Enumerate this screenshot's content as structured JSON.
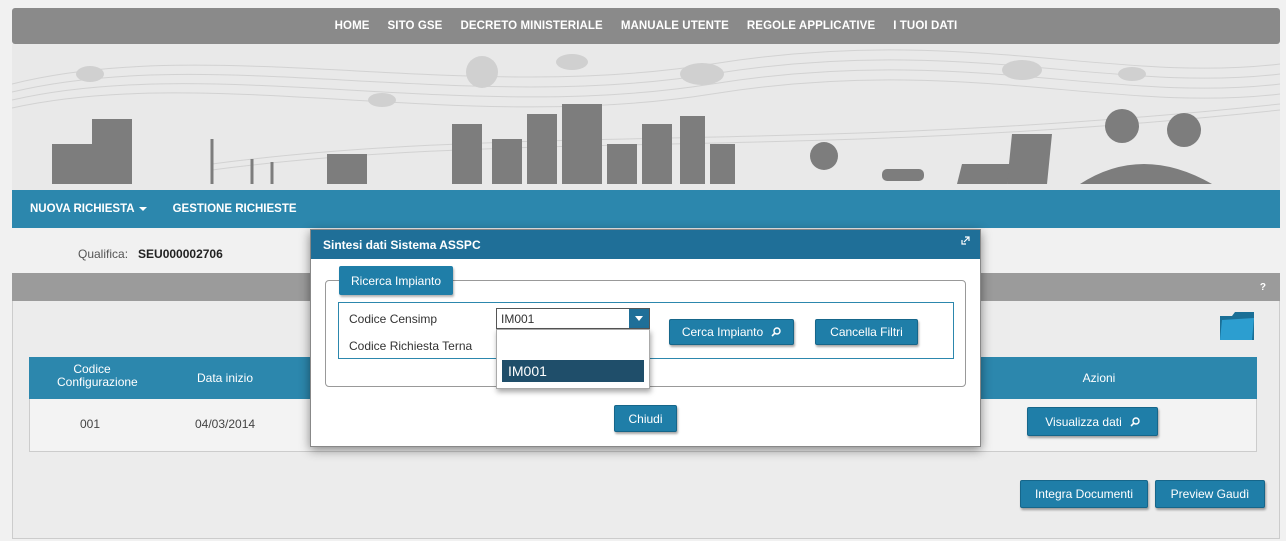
{
  "topnav": [
    "HOME",
    "SITO GSE",
    "DECRETO MINISTERIALE",
    "MANUALE UTENTE",
    "REGOLE APPLICATIVE",
    "I TUOI DATI"
  ],
  "menubar": {
    "nuova_richiesta": "NUOVA RICHIESTA",
    "gestione_richieste": "GESTIONE RICHIESTE"
  },
  "qualifica": {
    "label": "Qualifica:",
    "value": "SEU000002706"
  },
  "panel": {
    "help": "?"
  },
  "table": {
    "headers": {
      "codice_line1": "Codice",
      "codice_line2": "Configurazione",
      "data_inizio": "Data inizio",
      "azioni": "Azioni"
    },
    "rows": [
      {
        "codice": "001",
        "data_inizio": "04/03/2014"
      }
    ],
    "view_button": "Visualizza dati"
  },
  "footer_buttons": {
    "integra": "Integra Documenti",
    "preview": "Preview Gaudì"
  },
  "modal": {
    "title": "Sintesi dati Sistema ASSPC",
    "legend": "Ricerca Impianto",
    "codice_censimp_label": "Codice Censimp",
    "codice_richiesta_label": "Codice Richiesta Terna",
    "select_value": "IM001",
    "dropdown_option": "IM001",
    "search_button": "Cerca Impianto",
    "clear_button": "Cancella Filtri",
    "close_button": "Chiudi"
  },
  "colors": {
    "accent": "#2c87ad",
    "modal_header": "#1f6f98",
    "nav": "#8a8a8a"
  }
}
